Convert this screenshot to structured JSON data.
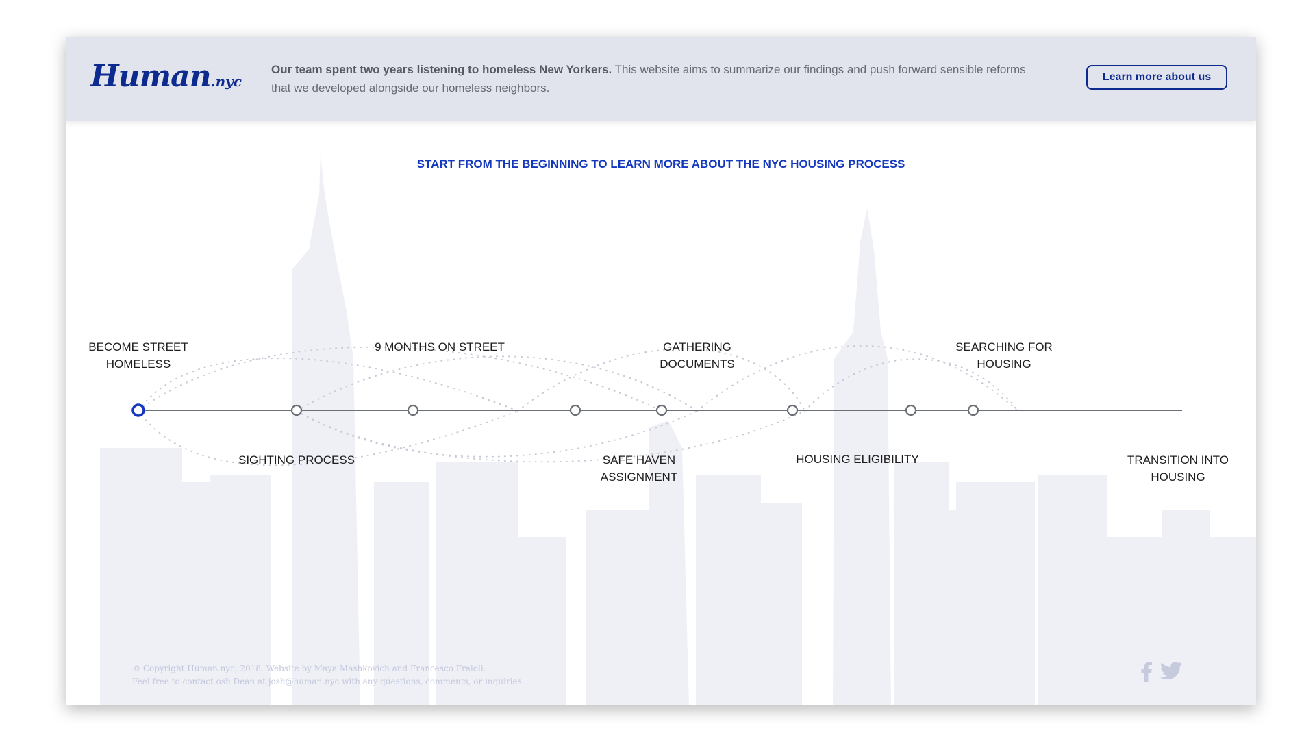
{
  "header": {
    "logo_text": "Human",
    "logo_suffix": ".nyc",
    "intro_lead": "Our team spent two years listening to homeless New Yorkers.",
    "intro_rest": " This website aims to summarize our findings and push forward sensible reforms that we developed alongside our homeless neighbors.",
    "learn_more_label": "Learn more about us"
  },
  "main": {
    "headline": "START FROM THE BEGINNING TO LEARN MORE ABOUT THE NYC HOUSING PROCESS",
    "steps": [
      {
        "label": "BECOME STREET HOMELESS",
        "active": true
      },
      {
        "label": "SIGHTING PROCESS",
        "active": false
      },
      {
        "label": "9 MONTHS ON STREET",
        "active": false
      },
      {
        "label": "SAFE HAVEN ASSIGNMENT",
        "active": false
      },
      {
        "label": "GATHERING DOCUMENTS",
        "active": false
      },
      {
        "label": "HOUSING ELIGIBILITY",
        "active": false
      },
      {
        "label": "SEARCHING FOR HOUSING",
        "active": false
      },
      {
        "label": "TRANSITION INTO HOUSING",
        "active": false
      }
    ]
  },
  "footer": {
    "copyright": "© Copyright Human.nyc, 2018. Website by Maya Mashkovich and Francesco Fraioli.",
    "contact": "Feel free to contact osh Dean at josh@human.nyc with any questions, comments, or inquiries"
  },
  "social": {
    "facebook_icon": "facebook-icon",
    "twitter_icon": "twitter-icon"
  },
  "colors": {
    "brand_blue": "#0d2a8f",
    "accent_blue": "#1438bd",
    "header_bg": "#e1e4ed",
    "skyline": "#eef0f6"
  }
}
